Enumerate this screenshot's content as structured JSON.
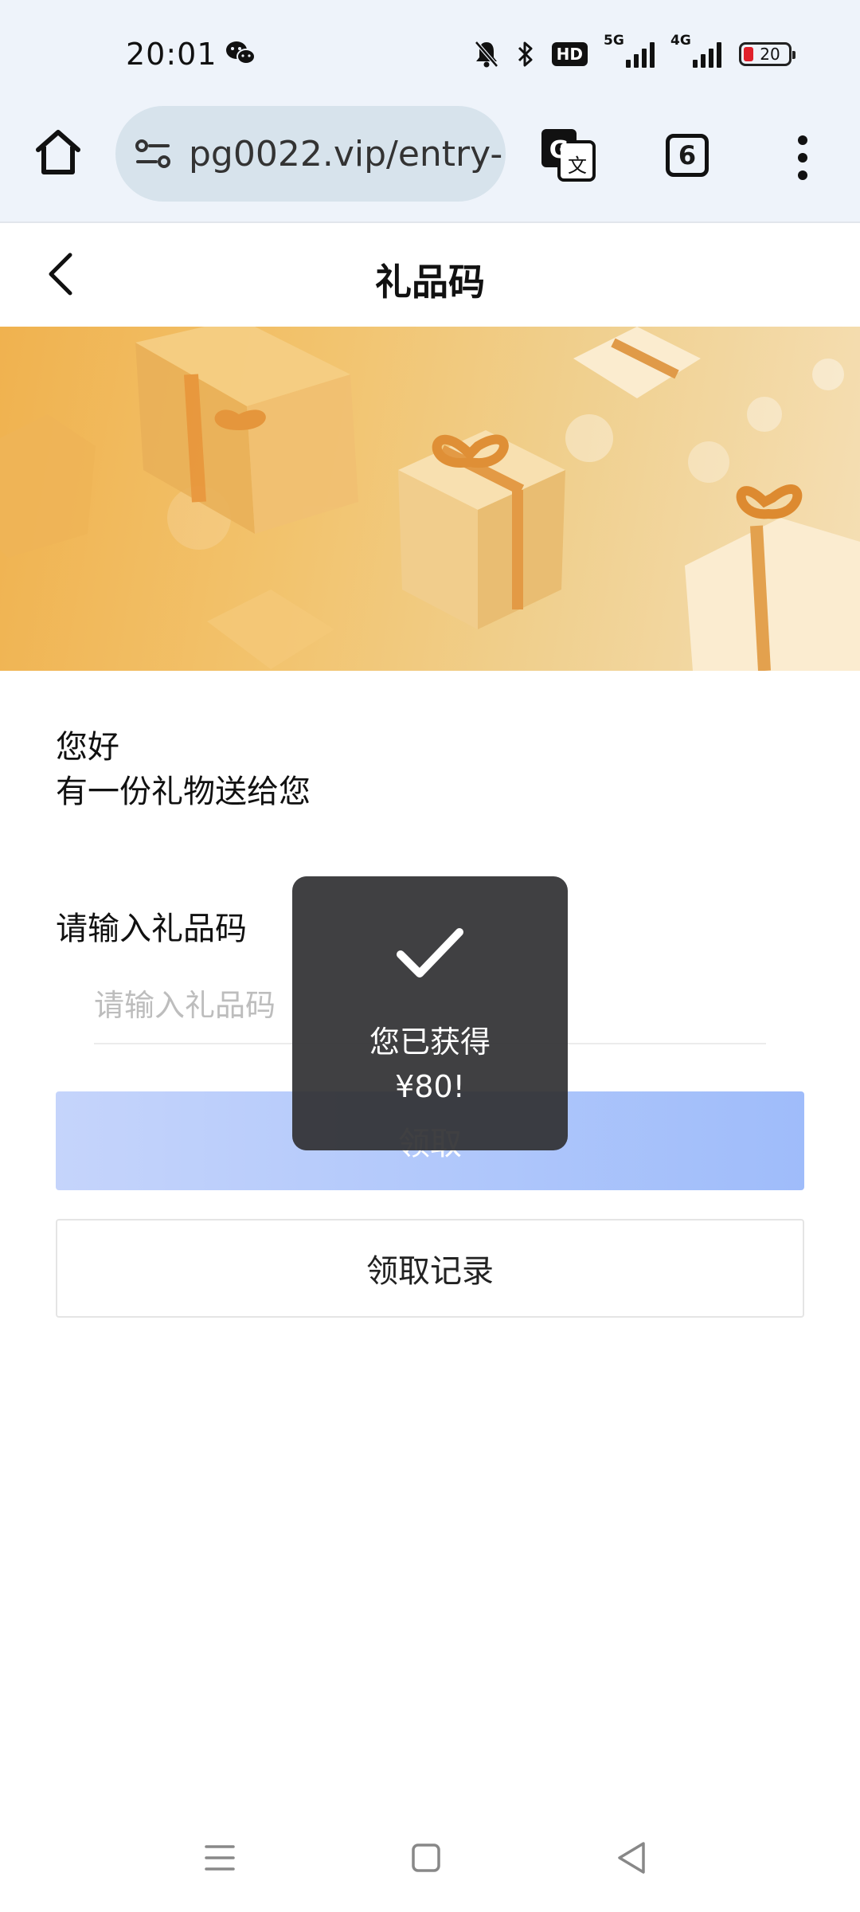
{
  "status_bar": {
    "time": "20:01",
    "network_1": "5G",
    "network_2": "4G",
    "hd_label": "HD",
    "battery": "20",
    "icons": [
      "wechat-icon",
      "mute-bell-icon",
      "bluetooth-icon",
      "hd-voice-icon",
      "signal-5g-icon",
      "signal-4g-icon",
      "battery-icon"
    ]
  },
  "browser": {
    "url": "pg0022.vip/entry-",
    "tab_count": "6",
    "icons": [
      "home-icon",
      "site-settings-icon",
      "translate-icon",
      "tabs-icon",
      "more-menu-icon"
    ]
  },
  "page": {
    "title": "礼品码",
    "back_icon": "chevron-left-icon"
  },
  "content": {
    "greeting_line1": "您好",
    "greeting_line2": "有一份礼物送给您",
    "field_label": "请输入礼品码",
    "input_placeholder": "请输入礼品码",
    "claim_button": "领取",
    "records_button": "领取记录"
  },
  "toast": {
    "line1": "您已获得",
    "line2": "¥80!",
    "icon": "checkmark-icon"
  },
  "nav_bar": {
    "icons": [
      "recents-icon",
      "home-square-icon",
      "back-triangle-icon"
    ]
  },
  "colors": {
    "status_bg": "#eef3fa",
    "url_pill": "#d7e3ec",
    "banner_gold": "#f0b24f",
    "claim_button": "#aec6fb",
    "toast_bg": "#303032"
  }
}
